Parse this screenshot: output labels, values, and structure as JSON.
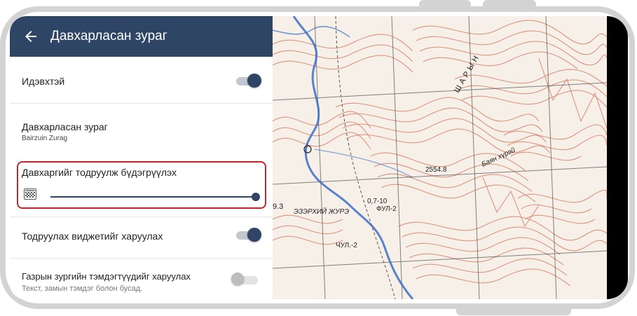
{
  "app_bar": {
    "title": "Давхарласан зураг"
  },
  "settings": {
    "enabled": {
      "label": "Идэвхтэй",
      "on": true
    },
    "overlay": {
      "label": "Давхарласан зураг",
      "value": "Bairzuin Zurag"
    },
    "transparency": {
      "label": "Давхаргийг тодруулж бүдэгрүүлэх",
      "level": 1.0
    },
    "show_widget": {
      "label": "Тодруулах виджетийг харуулах",
      "on": true
    },
    "show_map_symbols": {
      "label": "Газрын зургийн тэмдэгтүүдийг харуулах",
      "description": "Текст, замын тэмдэг болон бусад.",
      "on": false
    }
  },
  "map": {
    "labels": [
      "2554.8",
      "Баян хүрэй",
      "ШАРЫН",
      "ЭЗЭРХИЙ ЖУРЭ",
      "0,7-10",
      "ФУЛ-2",
      "ЧУЛ.-2",
      "9.3"
    ],
    "colors": {
      "contour": "#d9826a",
      "river": "#3d6fc4",
      "grid": "#333333",
      "paper": "#f6f0e8"
    }
  },
  "colors": {
    "primary": "#2f4565",
    "highlight": "#c8222a"
  },
  "icons": {
    "back": "arrow-left-icon",
    "opacity": "transparency-checker-icon"
  }
}
